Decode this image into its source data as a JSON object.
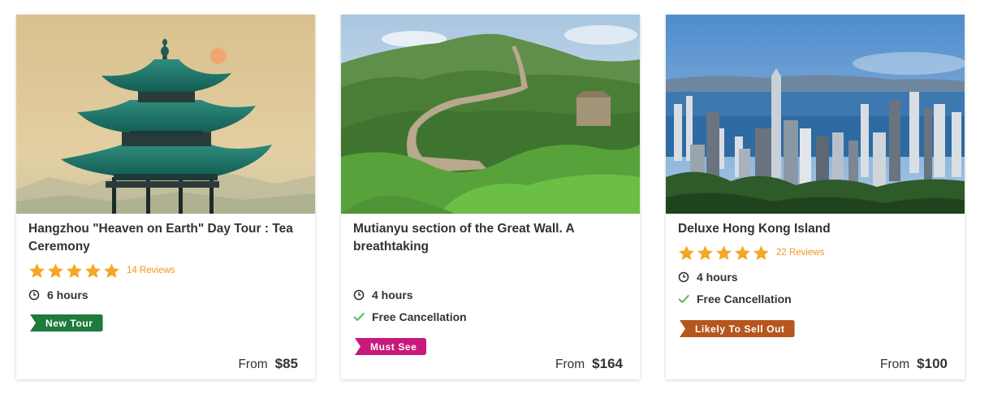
{
  "cards": [
    {
      "title": "Hangzhou \"Heaven on Earth\" Day Tour : Tea Ceremony",
      "image": "pagoda-sunset",
      "stars": 5,
      "reviews": "14  Reviews",
      "duration": "6 hours",
      "badge": {
        "label": "New Tour",
        "color": "#1e7b3c"
      },
      "price_prefix": "From",
      "price": "$85"
    },
    {
      "title": "Mutianyu section of the Great Wall. A breathtaking",
      "image": "great-wall",
      "duration": "4 hours",
      "cancellation": "Free Cancellation",
      "badge": {
        "label": "Must See",
        "color": "#c8197a"
      },
      "price_prefix": "From",
      "price": "$164"
    },
    {
      "title": "Deluxe Hong Kong Island",
      "image": "hong-kong-skyline",
      "stars": 5,
      "reviews": "22  Reviews",
      "duration": "4 hours",
      "cancellation": "Free Cancellation",
      "badge": {
        "label": "Likely To Sell Out",
        "color": "#b5561f"
      },
      "price_prefix": "From",
      "price": "$100"
    }
  ],
  "colors": {
    "star": "#f5a623",
    "reviews": "#f0961e",
    "check": "#5cb85c",
    "text": "#333333"
  },
  "icons": {
    "duration": "clock-icon",
    "cancellation": "check-icon",
    "rating": "star-icon"
  }
}
